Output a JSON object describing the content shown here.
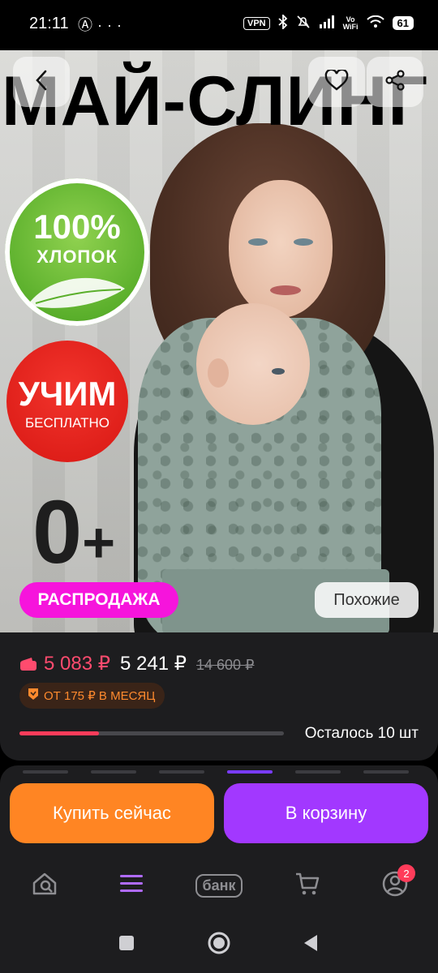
{
  "status_bar": {
    "time": "21:11",
    "left_icons": [
      "anarchy-icon",
      "more-dots-icon"
    ],
    "vpn": "VPN",
    "vowifi_top": "Vo",
    "vowifi_bottom": "WiFi",
    "battery": "61"
  },
  "hero": {
    "headline": "МАЙ-СЛИНГ",
    "cotton_badge_big": "100%",
    "cotton_badge_small": "ХЛОПОК",
    "teach_badge_big": "УЧИМ",
    "teach_badge_small": "БЕСПЛАТНО",
    "age_value": "0",
    "age_plus": "+",
    "sale_label": "РАСПРОДАЖА",
    "similar_label": "Похожие"
  },
  "price": {
    "wallet_price": "5 083 ₽",
    "current_price": "5 241 ₽",
    "old_price": "14 600 ₽",
    "installment": "ОТ 175 ₽ В МЕСЯЦ",
    "stock_text": "Осталось 10 шт",
    "stock_fraction": 0.3
  },
  "actions": {
    "buy_now": "Купить сейчас",
    "add_to_cart": "В корзину"
  },
  "bottom_nav": {
    "bank_label": "банк",
    "profile_badge": "2"
  },
  "colors": {
    "accent_pink": "#f614dc",
    "buy_orange": "#ff8523",
    "cart_purple": "#a238ff",
    "price_red": "#ff4b6e"
  }
}
